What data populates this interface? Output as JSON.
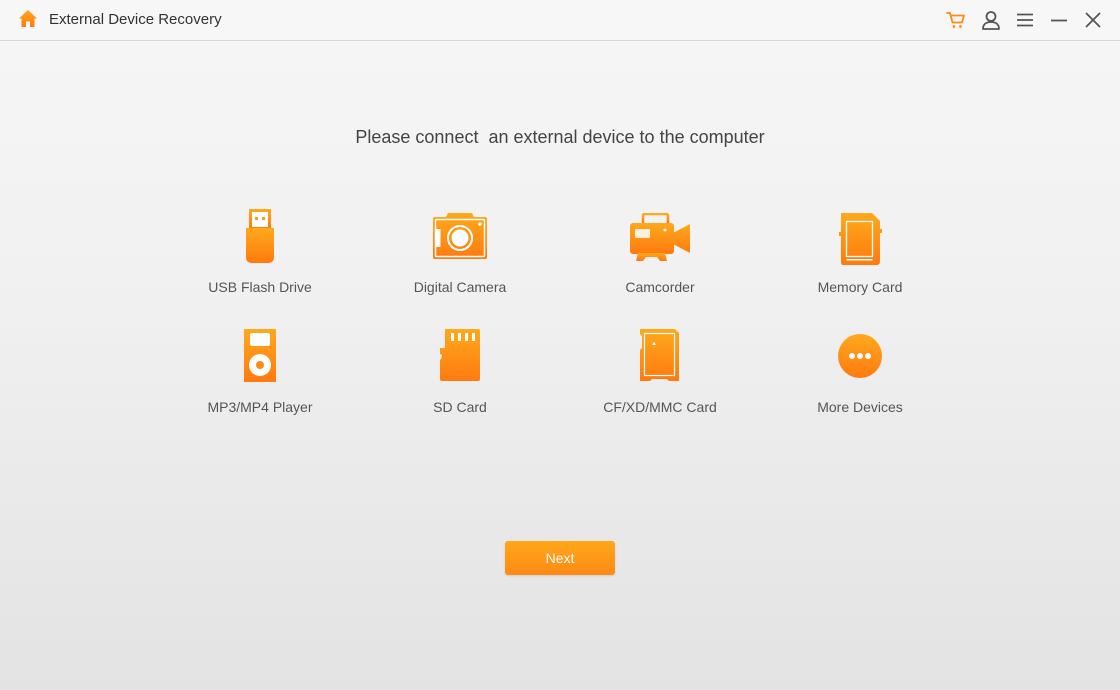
{
  "window": {
    "title": "External Device Recovery",
    "controls": {
      "cart": "cart-icon",
      "account": "user-icon",
      "menu": "menu-icon",
      "minimize": "minimize-icon",
      "close": "close-icon"
    }
  },
  "colors": {
    "accent": "#ff9a1a",
    "accent_dark": "#ff7f11",
    "text": "#444444",
    "label": "#555555",
    "icon_gray": "#555555"
  },
  "main": {
    "prompt": "Please connect  an external device to the computer",
    "devices": [
      {
        "label": "USB Flash Drive",
        "icon": "usb-drive-icon"
      },
      {
        "label": "Digital Camera",
        "icon": "camera-icon"
      },
      {
        "label": "Camcorder",
        "icon": "camcorder-icon"
      },
      {
        "label": "Memory Card",
        "icon": "memory-card-icon"
      },
      {
        "label": "MP3/MP4 Player",
        "icon": "mp3-player-icon"
      },
      {
        "label": "SD Card",
        "icon": "sd-card-icon"
      },
      {
        "label": "CF/XD/MMC Card",
        "icon": "cf-card-icon"
      },
      {
        "label": "More Devices",
        "icon": "more-icon"
      }
    ],
    "next_label": "Next"
  }
}
